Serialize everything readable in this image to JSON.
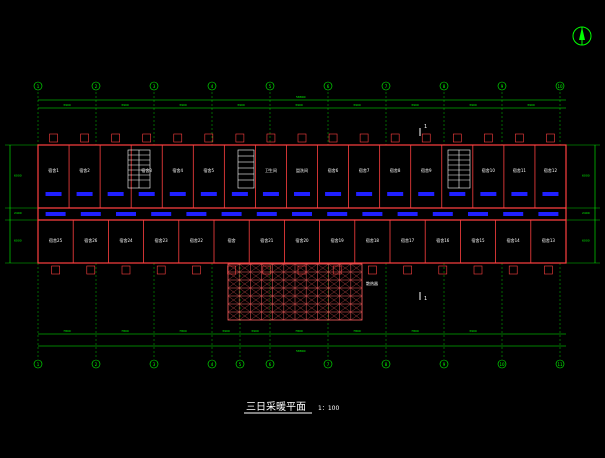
{
  "drawing": {
    "title": "三日采暖平面",
    "scale": "1：100",
    "north_label": "N"
  },
  "top_dimensions": {
    "overall": "58800",
    "segments": [
      "3900",
      "3900",
      "3900",
      "3900",
      "3900",
      "3900",
      "3900",
      "3900",
      "3900",
      "3900",
      "3900",
      "3900",
      "3900",
      "3900",
      "3900"
    ]
  },
  "bottom_dimensions": {
    "overall": "58800",
    "segments": [
      "7800",
      "7800",
      "7800",
      "3900",
      "3900",
      "7800",
      "7800",
      "7800",
      "3900"
    ]
  },
  "left_dimensions": {
    "segments": [
      "6000",
      "2400",
      "6000"
    ]
  },
  "right_dimensions": {
    "segments": [
      "6000",
      "2400",
      "6000"
    ]
  },
  "axis_labels_top": [
    "1",
    "2",
    "3",
    "4",
    "5",
    "6",
    "7",
    "8",
    "9",
    "10",
    "11",
    "12",
    "13",
    "14",
    "15",
    "16"
  ],
  "axis_labels_bottom": [
    "1",
    "2",
    "3",
    "4",
    "5",
    "6",
    "7",
    "8",
    "9",
    "10",
    "11",
    "12",
    "13",
    "14",
    "15",
    "16"
  ],
  "axis_labels_side": [
    "D",
    "C",
    "B",
    "A"
  ],
  "rooms_north": [
    {
      "label": "宿舍1"
    },
    {
      "label": "宿舍2"
    },
    {
      "label": ""
    },
    {
      "label": "宿舍3"
    },
    {
      "label": "宿舍4"
    },
    {
      "label": "宿舍5"
    },
    {
      "label": ""
    },
    {
      "label": "卫生间"
    },
    {
      "label": "盥洗间"
    },
    {
      "label": "宿舍6"
    },
    {
      "label": "宿舍7"
    },
    {
      "label": "宿舍8"
    },
    {
      "label": "宿舍9"
    },
    {
      "label": ""
    },
    {
      "label": "宿舍10"
    },
    {
      "label": "宿舍11"
    },
    {
      "label": "宿舍12"
    }
  ],
  "rooms_south": [
    {
      "label": "宿舍25"
    },
    {
      "label": "宿舍26"
    },
    {
      "label": "宿舍24"
    },
    {
      "label": "宿舍23"
    },
    {
      "label": "宿舍22"
    },
    {
      "label": "宿舍"
    },
    {
      "label": "宿舍21"
    },
    {
      "label": "宿舍20"
    },
    {
      "label": "宿舍19"
    },
    {
      "label": "宿舍18"
    },
    {
      "label": "宿舍17"
    },
    {
      "label": "宿舍16"
    },
    {
      "label": "宿舍15"
    },
    {
      "label": "宿舍14"
    },
    {
      "label": "宿舍13"
    }
  ],
  "section_markers": [
    "1",
    "1"
  ],
  "annotations": {
    "grid_note": "散热器"
  },
  "colors": {
    "background": "#000000",
    "wall": "#ff4040",
    "dimension": "#00ff00",
    "axis": "#00ff00",
    "radiator": "#2020ff",
    "text": "#ffffff",
    "grid": "#ff6060"
  }
}
